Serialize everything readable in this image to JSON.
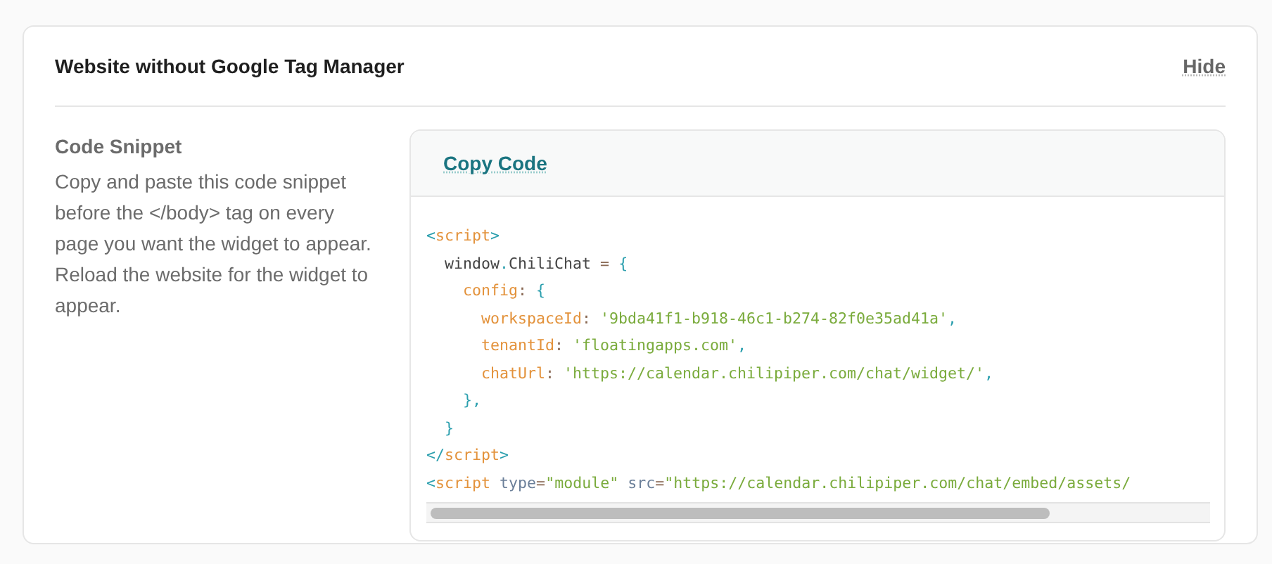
{
  "card": {
    "title": "Website without Google Tag Manager",
    "hide_link": "Hide"
  },
  "section": {
    "heading": "Code Snippet",
    "description": "Copy and paste this code snippet before the </body> tag on every page you want the widget to appear. Reload the website for the widget to appear."
  },
  "code_panel": {
    "copy_button": "Copy Code",
    "lines": [
      [
        {
          "kind": "tag",
          "text": "<"
        },
        {
          "kind": "key",
          "text": "script"
        },
        {
          "kind": "tag",
          "text": ">"
        }
      ],
      [
        {
          "kind": "plain",
          "text": "  window"
        },
        {
          "kind": "punct",
          "text": "."
        },
        {
          "kind": "plain",
          "text": "ChiliChat "
        },
        {
          "kind": "op",
          "text": "="
        },
        {
          "kind": "punct",
          "text": " {"
        }
      ],
      [
        {
          "kind": "key",
          "text": "    config"
        },
        {
          "kind": "op",
          "text": ": "
        },
        {
          "kind": "punct",
          "text": "{"
        }
      ],
      [
        {
          "kind": "key",
          "text": "      workspaceId"
        },
        {
          "kind": "op",
          "text": ": "
        },
        {
          "kind": "string",
          "text": "'9bda41f1-b918-46c1-b274-82f0e35ad41a'"
        },
        {
          "kind": "punct",
          "text": ","
        }
      ],
      [
        {
          "kind": "key",
          "text": "      tenantId"
        },
        {
          "kind": "op",
          "text": ": "
        },
        {
          "kind": "string",
          "text": "'floatingapps.com'"
        },
        {
          "kind": "punct",
          "text": ","
        }
      ],
      [
        {
          "kind": "key",
          "text": "      chatUrl"
        },
        {
          "kind": "op",
          "text": ": "
        },
        {
          "kind": "string",
          "text": "'https://calendar.chilipiper.com/chat/widget/'"
        },
        {
          "kind": "punct",
          "text": ","
        }
      ],
      [
        {
          "kind": "punct",
          "text": "    },"
        }
      ],
      [
        {
          "kind": "punct",
          "text": "  }"
        }
      ],
      [
        {
          "kind": "tag",
          "text": "</"
        },
        {
          "kind": "key",
          "text": "script"
        },
        {
          "kind": "tag",
          "text": ">"
        }
      ],
      [
        {
          "kind": "tag",
          "text": "<"
        },
        {
          "kind": "key",
          "text": "script"
        },
        {
          "kind": "attr",
          "text": " type"
        },
        {
          "kind": "op",
          "text": "="
        },
        {
          "kind": "string",
          "text": "\"module\""
        },
        {
          "kind": "attr",
          "text": " src"
        },
        {
          "kind": "op",
          "text": "="
        },
        {
          "kind": "string",
          "text": "\"https://calendar.chilipiper.com/chat/embed/assets/"
        }
      ]
    ]
  }
}
